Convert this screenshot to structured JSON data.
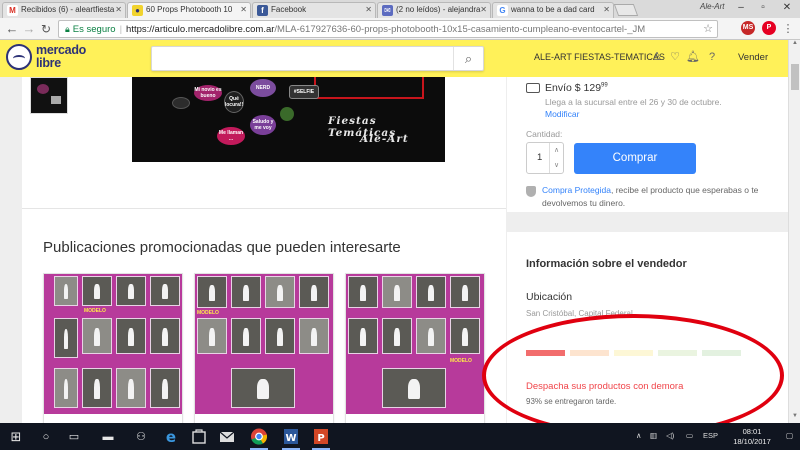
{
  "browser": {
    "tabs": [
      {
        "title": "Recibidos (6) - aleartfiesta",
        "icon": "gmail-icon",
        "color": "#d93025",
        "letter": "M"
      },
      {
        "title": "60 Props Photobooth 10",
        "icon": "mercadolibre-icon",
        "color": "#f1d32e",
        "letter": "•",
        "active": true
      },
      {
        "title": "Facebook",
        "icon": "facebook-icon",
        "color": "#3b5998",
        "letter": "f"
      },
      {
        "title": "(2 no leídos) - alejandra",
        "icon": "mail-icon",
        "color": "#5c6bc0",
        "letter": "✉"
      },
      {
        "title": "wanna to be a dad card",
        "icon": "google-icon",
        "color": "#4285f4",
        "letter": "G"
      }
    ],
    "profile_name": "Ale-Art",
    "secure_label": "Es seguro",
    "url_host": "https://articulo.mercadolibre.com.ar",
    "url_path": "/MLA-617927636-60-props-photobooth-10x15-casamiento-cumpleano-eventocartel-_JM"
  },
  "ml_header": {
    "brand_line1": "mercado",
    "brand_line2": "libre",
    "search_placeholder": "",
    "user_label": "ALE-ART FIESTAS-TEMATICAS",
    "sell_label": "Vender"
  },
  "product_image": {
    "caption_line1": "Fiestas Temáticas",
    "caption_line2": "Ale-Art",
    "props": [
      "#SELFIE",
      "NERD",
      "Qué locura!!",
      "Saludo y me voy",
      "Me llaman ...",
      "Mi novio es bueno"
    ]
  },
  "promotions": {
    "title": "Publicaciones promocionadas que pueden interesarte",
    "card_labels": [
      "MODELO",
      "MODELO",
      "MODELO"
    ]
  },
  "purchase": {
    "shipping_label": "Envío $ 129",
    "shipping_cents": "99",
    "arrival_text": "Llega a la sucursal entre el 26 y 30 de octubre.",
    "modify_link": "Modificar",
    "quantity_label": "Cantidad:",
    "quantity_value": "1",
    "buy_button": "Comprar",
    "protection_link": "Compra Protegida",
    "protection_text": ", recibe el producto que esperabas o te devolvemos tu dinero."
  },
  "seller": {
    "title": "Información sobre el vendedor",
    "location_title": "Ubicación",
    "location_value": "San Cristóbal, Capital Federal",
    "reputation_colors": [
      "#f26d6d",
      "#fde4cf",
      "#fdf7d6",
      "#eaf4e0",
      "#e3f1e0"
    ],
    "dispatch_warning": "Despacha sus productos con demora",
    "late_text": "93% se entregaron tarde."
  },
  "taskbar": {
    "language": "ESP",
    "time": "08:01",
    "date": "18/10/2017",
    "apps": [
      {
        "name": "edge-icon",
        "color": "#1f7ad8"
      },
      {
        "name": "store-icon",
        "color": "#d8d8d8"
      },
      {
        "name": "mail-icon",
        "color": "#d8d8d8"
      },
      {
        "name": "chrome-icon",
        "color": "#e2a424"
      },
      {
        "name": "word-icon",
        "color": "#2b579a"
      },
      {
        "name": "powerpoint-icon",
        "color": "#d24726"
      }
    ]
  }
}
